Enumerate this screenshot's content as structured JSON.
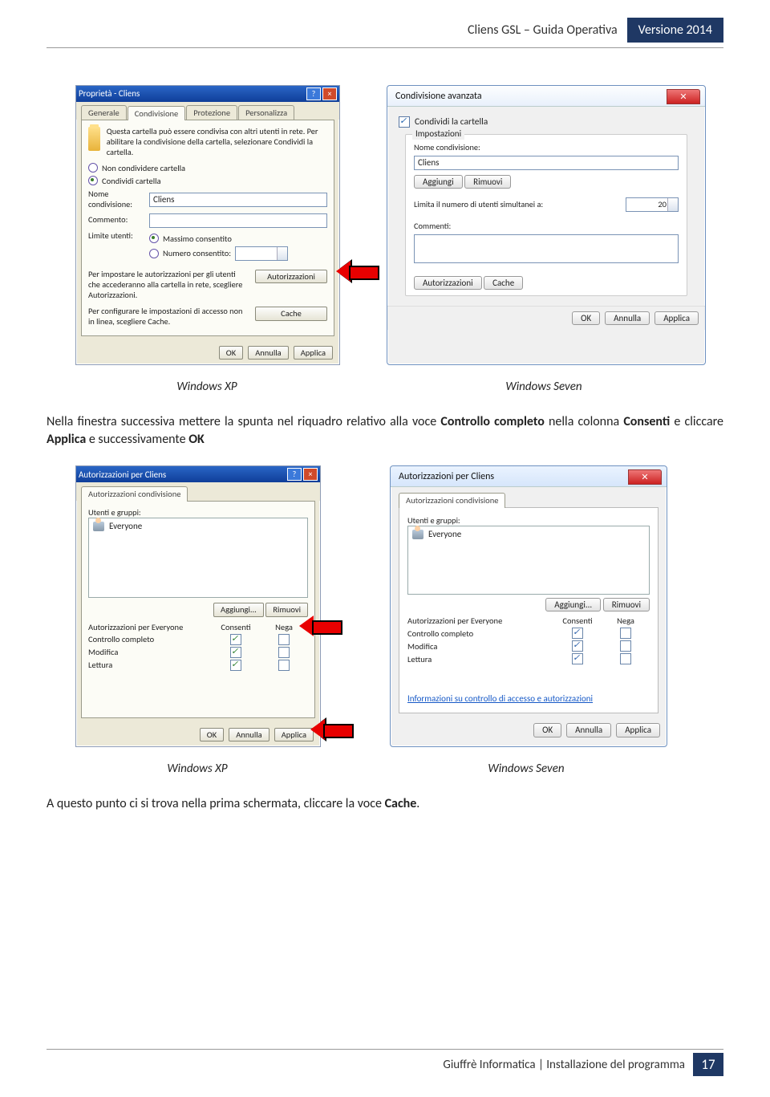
{
  "header": {
    "title": "Cliens GSL – Guida Operativa",
    "badge": "Versione 2014"
  },
  "footer": {
    "text": "Giuffrè Informatica | Installazione del programma",
    "page": "17"
  },
  "captions": {
    "xp": "Windows XP",
    "seven": "Windows Seven"
  },
  "para1_pre": "Nella finestra successiva mettere la spunta nel riquadro relativo alla voce ",
  "para1_b1": "Controllo completo",
  "para1_mid": " nella colonna ",
  "para1_b2": "Consenti",
  "para1_mid2": " e cliccare ",
  "para1_b3": "Applica",
  "para1_mid3": " e successivamente ",
  "para1_b4": "OK",
  "para2_pre": "A questo punto ci si trova nella prima schermata, cliccare la voce ",
  "para2_b1": "Cache",
  "para2_post": ".",
  "xp_props": {
    "title": "Proprietà - Cliens",
    "tabs": [
      "Generale",
      "Condivisione",
      "Protezione",
      "Personalizza"
    ],
    "info": "Questa cartella può essere condivisa con altri utenti in rete. Per abilitare la condivisione della cartella, selezionare Condividi la cartella.",
    "opt_no": "Non condividere cartella",
    "opt_yes": "Condividi cartella",
    "lbl_name": "Nome condivisione:",
    "val_name": "Cliens",
    "lbl_comment": "Commento:",
    "lbl_limit": "Limite utenti:",
    "opt_max": "Massimo consentito",
    "opt_num": "Numero consentito:",
    "note1": "Per impostare le autorizzazioni per gli utenti che accederanno alla cartella in rete, scegliere Autorizzazioni.",
    "note2": "Per configurare le impostazioni di accesso non in linea, scegliere Cache.",
    "btn_auth": "Autorizzazioni",
    "btn_cache": "Cache",
    "ok": "OK",
    "cancel": "Annulla",
    "apply": "Applica"
  },
  "w7_adv": {
    "title": "Condivisione avanzata",
    "chk_share": "Condividi la cartella",
    "grp": "Impostazioni",
    "lbl_name": "Nome condivisione:",
    "val_name": "Cliens",
    "btn_add": "Aggiungi",
    "btn_rem": "Rimuovi",
    "lbl_limit": "Limita il numero di utenti simultanei a:",
    "val_limit": "20",
    "lbl_comm": "Commenti:",
    "btn_auth": "Autorizzazioni",
    "btn_cache": "Cache",
    "ok": "OK",
    "cancel": "Annulla",
    "apply": "Applica"
  },
  "xp_perm": {
    "title": "Autorizzazioni per Cliens",
    "tab": "Autorizzazioni condivisione",
    "lbl_users": "Utenti e gruppi:",
    "user": "Everyone",
    "btn_add": "Aggiungi...",
    "btn_rem": "Rimuovi",
    "lbl_permfor": "Autorizzazioni per Everyone",
    "col_allow": "Consenti",
    "col_deny": "Nega",
    "rows": [
      "Controllo completo",
      "Modifica",
      "Lettura"
    ],
    "ok": "OK",
    "cancel": "Annulla",
    "apply": "Applica"
  },
  "w7_perm": {
    "title": "Autorizzazioni per Cliens",
    "tab": "Autorizzazioni condivisione",
    "lbl_users": "Utenti e gruppi:",
    "user": "Everyone",
    "btn_add": "Aggiungi...",
    "btn_rem": "Rimuovi",
    "lbl_permfor": "Autorizzazioni per Everyone",
    "col_allow": "Consenti",
    "col_deny": "Nega",
    "rows": [
      "Controllo completo",
      "Modifica",
      "Lettura"
    ],
    "link": "Informazioni su controllo di accesso e autorizzazioni",
    "ok": "OK",
    "cancel": "Annulla",
    "apply": "Applica"
  }
}
